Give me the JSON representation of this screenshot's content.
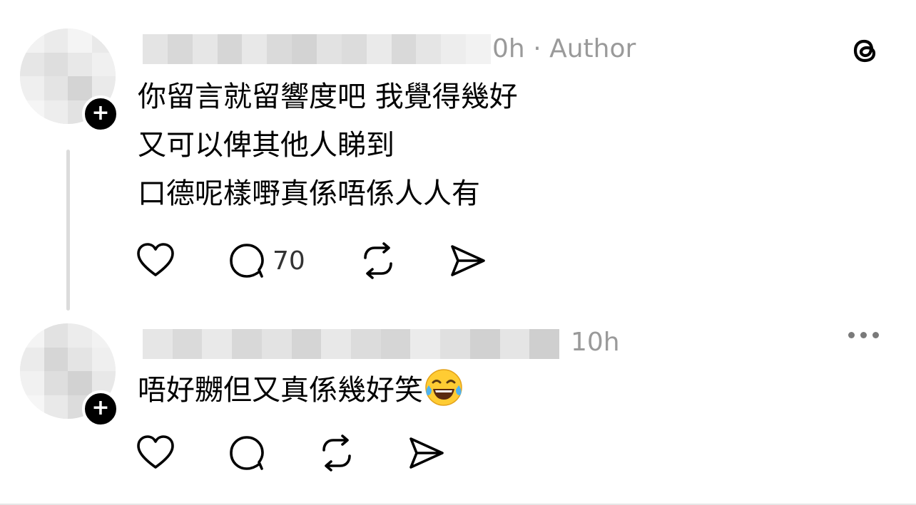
{
  "app": {
    "logo_icon": "threads-logo-icon"
  },
  "comments": [
    {
      "author_display": "",
      "time_partial": "0h",
      "separator": "·",
      "badge": "Author",
      "lines": [
        "你留言就留響度吧 我覺得幾好",
        "又可以俾其他人睇到",
        "口德呢樣嘢真係唔係人人有"
      ],
      "actions": {
        "like_icon": "heart-icon",
        "reply_icon": "reply-bubble-icon",
        "reply_count": "70",
        "repost_icon": "repost-icon",
        "share_icon": "send-icon"
      }
    },
    {
      "author_display": "",
      "time": "10h",
      "lines": [
        "唔好嬲但又真係幾好笑"
      ],
      "emoji": "face-with-tears-of-joy",
      "actions": {
        "like_icon": "heart-icon",
        "reply_icon": "reply-bubble-icon",
        "repost_icon": "repost-icon",
        "share_icon": "send-icon"
      },
      "menu_icon": "more-icon"
    }
  ],
  "colors": {
    "text": "#000000",
    "meta": "#9a9a9a",
    "thread_line": "#dcdcdc",
    "badge_bg": "#000000"
  }
}
